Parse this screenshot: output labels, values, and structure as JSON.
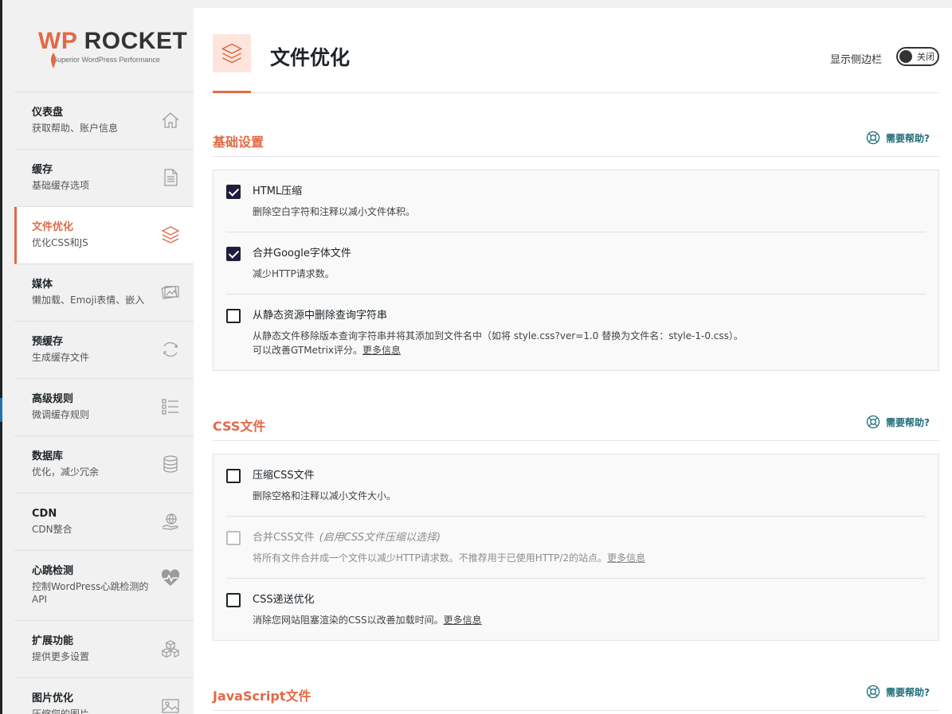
{
  "logo": {
    "brand_wp": "WP",
    "brand_rocket": " ROCKET",
    "tagline": "Superior WordPress Performance"
  },
  "colors": {
    "accent": "#e26945",
    "dark": "#1d2327",
    "help": "#1f6e7a",
    "checked": "#1e1e3c"
  },
  "nav": [
    {
      "title": "仪表盘",
      "sub": "获取帮助、账户信息",
      "icon": "home-icon"
    },
    {
      "title": "缓存",
      "sub": "基础缓存选项",
      "icon": "document-icon"
    },
    {
      "title": "文件优化",
      "sub": "优化CSS和JS",
      "icon": "layers-icon",
      "active": true
    },
    {
      "title": "媒体",
      "sub": "懒加载、Emoji表情、嵌入",
      "icon": "images-icon"
    },
    {
      "title": "预缓存",
      "sub": "生成缓存文件",
      "icon": "refresh-icon"
    },
    {
      "title": "高级规则",
      "sub": "微调缓存规则",
      "icon": "list-icon"
    },
    {
      "title": "数据库",
      "sub": "优化，减少冗余",
      "icon": "database-icon"
    },
    {
      "title": "CDN",
      "sub": "CDN整合",
      "icon": "globe-hand-icon"
    },
    {
      "title": "心跳检测",
      "sub": "控制WordPress心跳检测的API",
      "icon": "heartbeat-icon"
    },
    {
      "title": "扩展功能",
      "sub": "提供更多设置",
      "icon": "boxes-icon"
    },
    {
      "title": "图片优化",
      "sub": "压缩您的图片",
      "icon": "image-icon"
    }
  ],
  "header": {
    "title": "文件优化",
    "sidebar_label": "显示侧边栏",
    "toggle_text": "关闭"
  },
  "help_label": "需要帮助?",
  "sections": [
    {
      "title": "基础设置",
      "options": [
        {
          "label": "HTML压缩",
          "desc": "删除空白字符和注释以减小文件体积。",
          "checked": true
        },
        {
          "label": "合并Google字体文件",
          "desc": "减少HTTP请求数。",
          "checked": true
        },
        {
          "label": "从静态资源中删除查询字符串",
          "desc": "从静态文件移除版本查询字符串并将其添加到文件名中（如将 style.css?ver=1.0 替换为文件名：style-1-0.css）。",
          "desc2": "可以改善GTMetrix评分。",
          "link": "更多信息",
          "checked": false
        }
      ]
    },
    {
      "title": "CSS文件",
      "options": [
        {
          "label": "压缩CSS文件",
          "desc": "删除空格和注释以减小文件大小。",
          "checked": false
        },
        {
          "label": "合并CSS文件",
          "note": "(启用CSS文件压缩以选择)",
          "desc": "将所有文件合并成一个文件以减少HTTP请求数。不推荐用于已使用HTTP/2的站点。",
          "link": "更多信息",
          "checked": false,
          "disabled": true
        },
        {
          "label": "CSS递送优化",
          "desc": "消除您网站阻塞渲染的CSS以改善加载时间。",
          "link": "更多信息",
          "checked": false
        }
      ]
    },
    {
      "title": "JavaScript文件",
      "options": []
    }
  ]
}
